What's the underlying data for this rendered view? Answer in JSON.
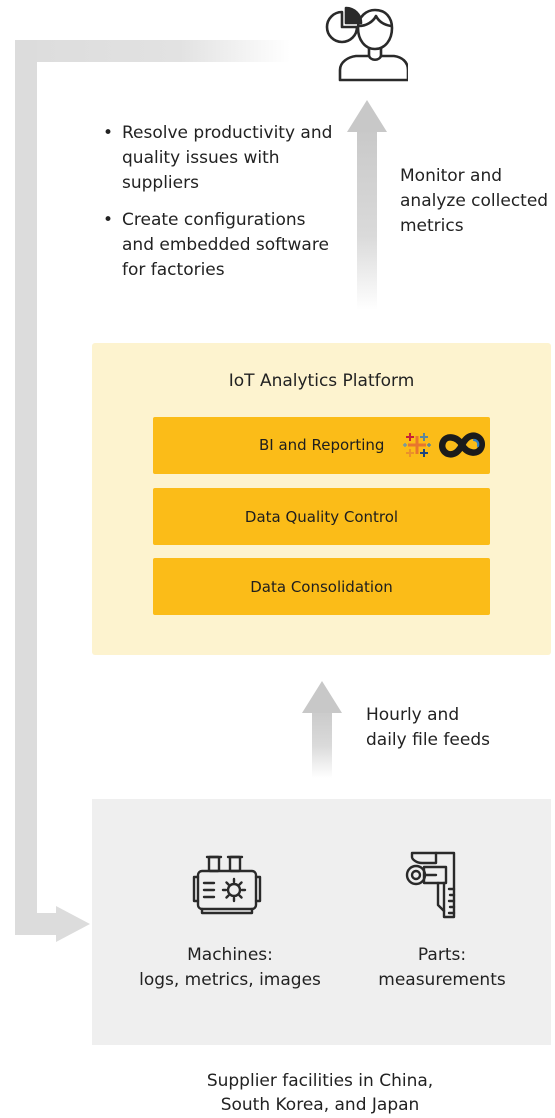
{
  "analyst": {
    "icon": "analyst-person-icon",
    "tasks": [
      "Resolve productivity and quality issues with suppliers",
      "Create configurations and embedded software for factories"
    ]
  },
  "monitor_note": "Monitor and\nanalyze collected\nmetrics",
  "platform": {
    "title": "IoT Analytics Platform",
    "layers": [
      {
        "label": "BI and Reporting",
        "icons": [
          "tableau-icon",
          "infinity-icon"
        ]
      },
      {
        "label": "Data Quality Control"
      },
      {
        "label": "Data Consolidation"
      }
    ]
  },
  "feeds_note": "Hourly and\ndaily file feeds",
  "suppliers": {
    "machines_caption": "Machines:\nlogs, metrics, images",
    "machines_icon": "machine-icon",
    "parts_caption": "Parts:\nmeasurements",
    "parts_icon": "caliper-icon",
    "caption": "Supplier facilities in China,\nSouth Korea, and Japan"
  },
  "colors": {
    "platform_bg": "#fdf3cf",
    "layer_fill": "#fbbc18",
    "supplier_bg": "#efefef",
    "arrow_grey": "#dcdcdc"
  }
}
